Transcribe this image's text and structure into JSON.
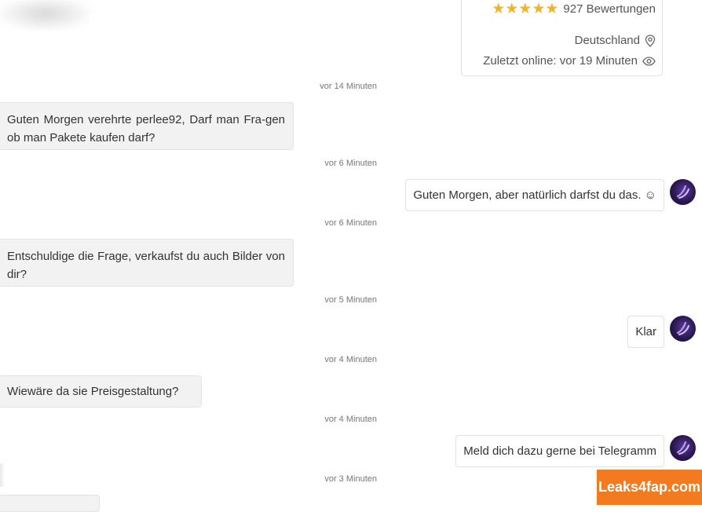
{
  "profile": {
    "rating_count": "927 Bewertungen",
    "stars": "★★★★★",
    "location": "Deutschland",
    "last_online": "Zuletzt online: vor 19 Minuten"
  },
  "messages": [
    {
      "time": "vor 14 Minuten",
      "side": "in",
      "text": "Guten Morgen verehrte perlee92, Darf man Fra-gen ob man Pakete kaufen darf?"
    },
    {
      "time": "vor 6 Minuten",
      "side": "out",
      "text": "Guten Morgen, aber natürlich darfst du das. ☺"
    },
    {
      "time": "vor 6 Minuten",
      "side": "in",
      "text": "Entschuldige die Frage, verkaufst du auch Bilder von dir?"
    },
    {
      "time": "vor 5 Minuten",
      "side": "out",
      "text": "Klar"
    },
    {
      "time": "vor 4 Minuten",
      "side": "in",
      "text": "Wiewäre da sie Preisgestaltung?"
    },
    {
      "time": "vor 4 Minuten",
      "side": "out",
      "text": "Meld dich dazu gerne bei Telegramm"
    },
    {
      "time": "vor 3 Minuten",
      "side": "in",
      "text": ""
    }
  ],
  "watermark": "Leaks4fap.com",
  "colors": {
    "star": "#f0b429",
    "incoming_bubble": "#f2f2f2",
    "watermark_bg": "#f37a1f"
  },
  "icons": {
    "location": "map-pin-icon",
    "online": "eye-icon",
    "avatar": "user-avatar"
  }
}
